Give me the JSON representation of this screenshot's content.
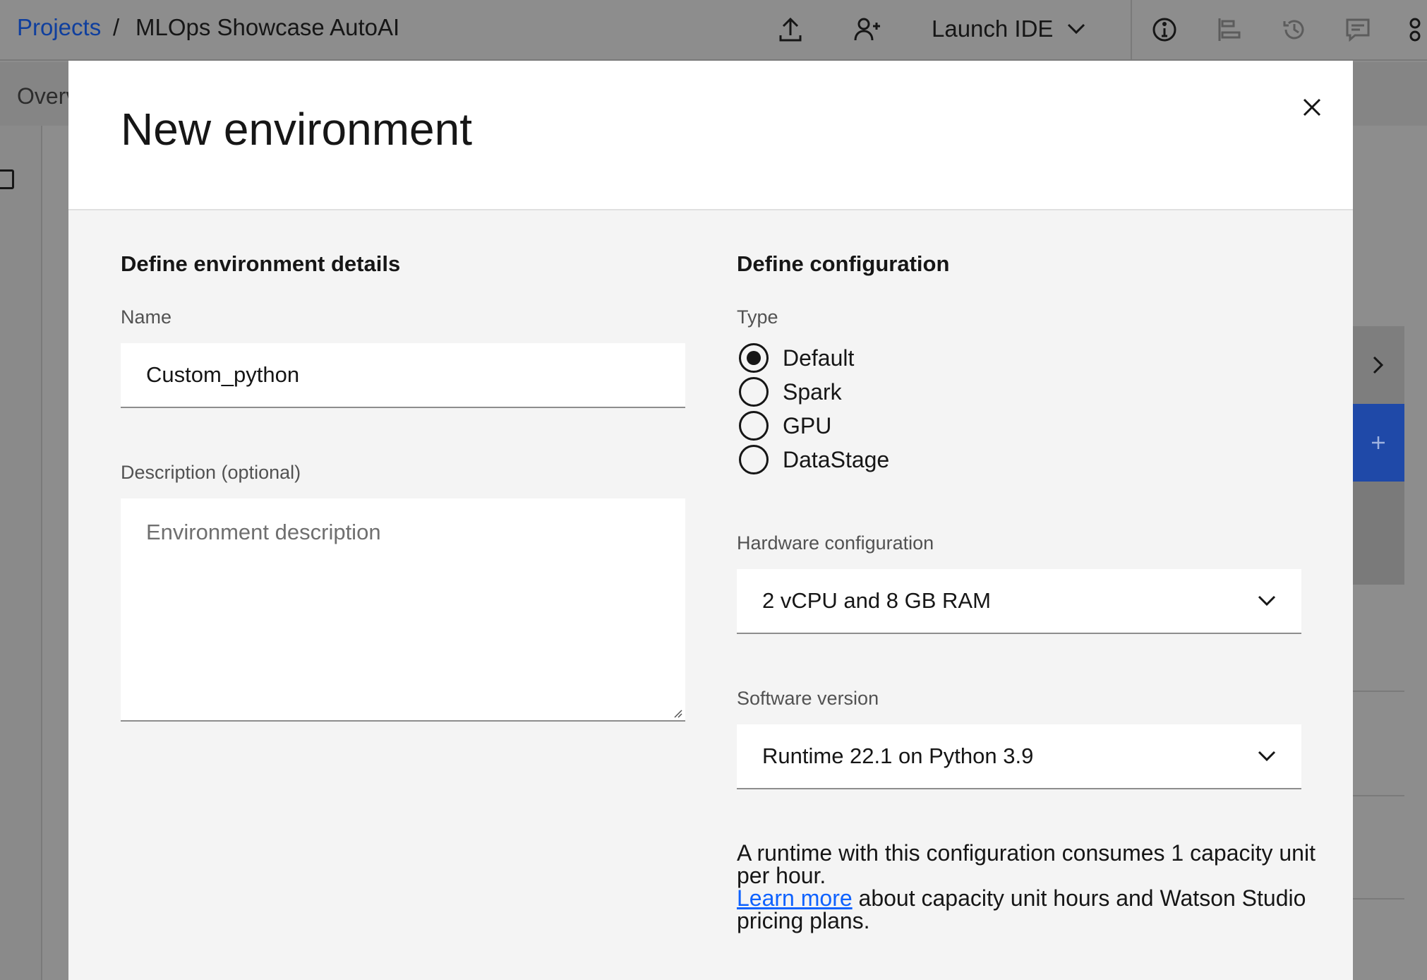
{
  "topbar": {
    "breadcrumb_root": "Projects",
    "breadcrumb_separator": "/",
    "project_name": "MLOps Showcase AutoAI",
    "launch_ide_label": "Launch IDE"
  },
  "tabs": {
    "overview_partial": "Overv"
  },
  "modal": {
    "title": "New environment",
    "left": {
      "section_title": "Define environment details",
      "name_label": "Name",
      "name_value": "Custom_python",
      "description_label": "Description (optional)",
      "description_placeholder": "Environment description"
    },
    "right": {
      "section_title": "Define configuration",
      "type_label": "Type",
      "type_options": [
        "Default",
        "Spark",
        "GPU",
        "DataStage"
      ],
      "type_selected": "Default",
      "hardware_label": "Hardware configuration",
      "hardware_value": "2 vCPU and 8 GB RAM",
      "software_label": "Software version",
      "software_value": "Runtime 22.1 on Python 3.9",
      "info_text_1": "A runtime with this configuration consumes 1 capacity unit per hour.",
      "learn_more": "Learn more",
      "info_text_2": " about capacity unit hours and Watson Studio pricing plans."
    }
  },
  "colors": {
    "overlay": "#8d8d8d",
    "link": "#0f62fe",
    "accent_blue": "#1f49a8",
    "text": "#161616",
    "label": "#525252"
  }
}
